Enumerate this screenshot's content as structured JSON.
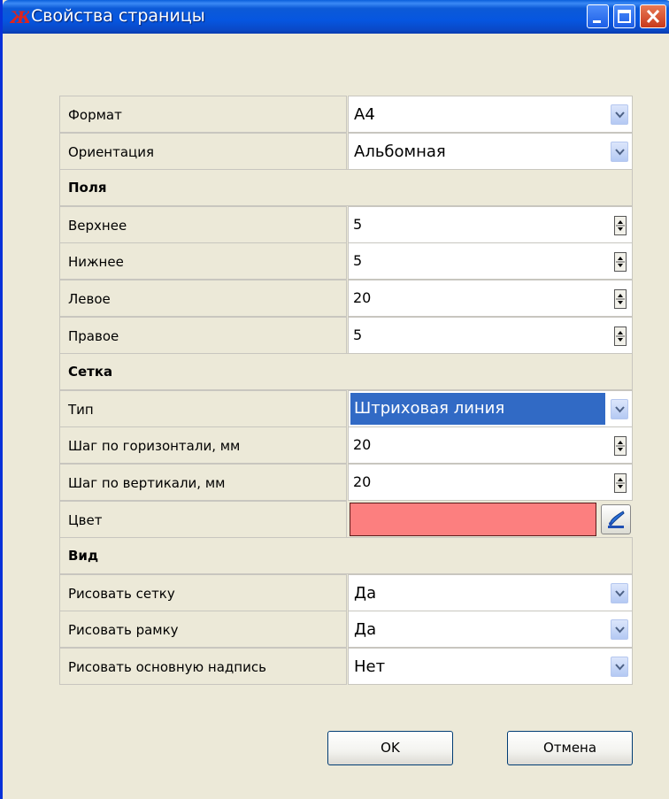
{
  "window": {
    "title": "Свойства страницы",
    "accent": "#0a5fdb"
  },
  "rows": [
    {
      "kind": "combo",
      "label": "Формат",
      "value": "А4"
    },
    {
      "kind": "combo",
      "label": "Ориентация",
      "value": "Альбомная"
    },
    {
      "kind": "section",
      "label": "Поля"
    },
    {
      "kind": "spin",
      "label": "Верхнее",
      "value": "5"
    },
    {
      "kind": "spin",
      "label": "Нижнее",
      "value": "5"
    },
    {
      "kind": "spin",
      "label": "Левое",
      "value": "20"
    },
    {
      "kind": "spin",
      "label": "Правое",
      "value": "5"
    },
    {
      "kind": "section",
      "label": "Сетка"
    },
    {
      "kind": "combo",
      "label": "Тип",
      "value": "Штриховая линия",
      "selected": true
    },
    {
      "kind": "spin",
      "label": "Шаг по горизонтали, мм",
      "value": "20"
    },
    {
      "kind": "spin",
      "label": "Шаг по вертикали, мм",
      "value": "20"
    },
    {
      "kind": "color",
      "label": "Цвет",
      "color": "#fc7f7f"
    },
    {
      "kind": "section",
      "label": "Вид"
    },
    {
      "kind": "combo",
      "label": "Рисовать сетку",
      "value": "Да"
    },
    {
      "kind": "combo",
      "label": "Рисовать рамку",
      "value": "Да"
    },
    {
      "kind": "combo",
      "label": "Рисовать основную надпись",
      "value": "Нет"
    }
  ],
  "buttons": {
    "ok": "OK",
    "cancel": "Отмена"
  },
  "icons": {
    "app": "app-logo-icon",
    "minimize": "minimize-icon",
    "maximize": "maximize-icon",
    "close": "close-icon",
    "dropdown": "chevron-down-icon",
    "spin": "spin-arrows-icon",
    "color_picker": "color-picker-icon"
  }
}
